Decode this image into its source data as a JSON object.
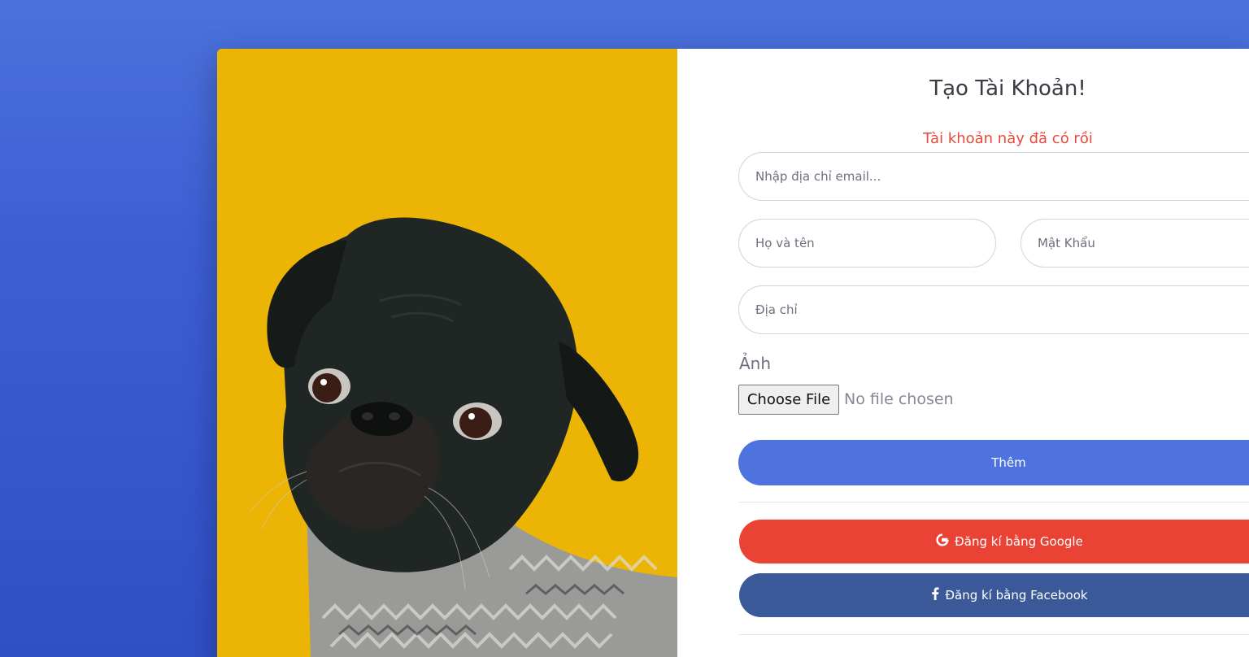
{
  "form": {
    "title": "Tạo Tài Khoản!",
    "error_message": "Tài khoản này đã có rồi",
    "email_placeholder": "Nhập địa chỉ email...",
    "name_placeholder": "Họ và tên",
    "password_placeholder": "Mật Khẩu",
    "address_placeholder": "Địa chỉ",
    "photo_label": "Ảnh",
    "file_button_label": "Choose File",
    "file_status": "No file chosen",
    "submit_label": "Thêm",
    "google_label": "Đăng kí bằng Google",
    "facebook_label": "Đăng kí bằng Facebook"
  },
  "icons": {
    "google": "google-icon",
    "facebook": "facebook-icon"
  },
  "colors": {
    "background": "#4b72dc",
    "photo_background": "#ecb405",
    "primary": "#4e73df",
    "google": "#ea4335",
    "facebook": "#3b5998",
    "error": "#e74a3b"
  }
}
